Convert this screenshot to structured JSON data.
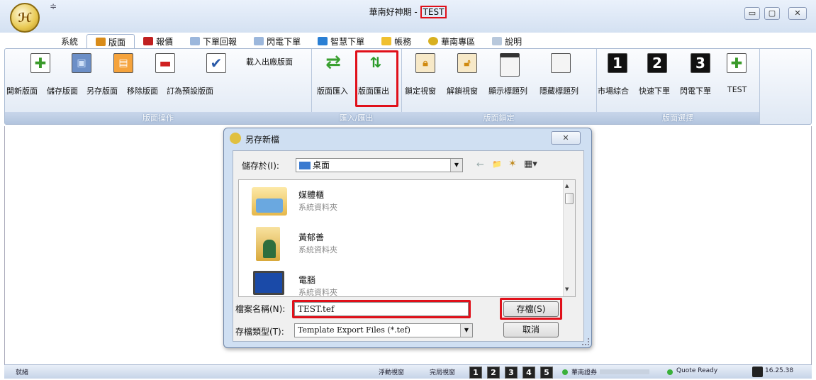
{
  "app": {
    "qat_text": "≑",
    "title_main": "華南好神期 -",
    "title_highlight": "TEST",
    "logo_text": "ℋ",
    "window_buttons": [
      "▭",
      "▢",
      "✕"
    ]
  },
  "menu": {
    "tabs": [
      {
        "label": "系統",
        "icon_color": "",
        "active": false
      },
      {
        "label": "版面",
        "icon_color": "#d98c1a",
        "active": true
      },
      {
        "label": "報價",
        "icon_color": "#c02020",
        "active": false
      },
      {
        "label": "下單回報",
        "icon_color": "#5c8fd0",
        "active": false
      },
      {
        "label": "閃電下單",
        "icon_color": "#5c8fd0",
        "active": false
      },
      {
        "label": "智慧下單",
        "icon_color": "#2a7fd4",
        "active": false
      },
      {
        "label": "帳務",
        "icon_color": "#f0c030",
        "active": false
      },
      {
        "label": "華南專區",
        "icon_color": "#d8b020",
        "active": false
      },
      {
        "label": "說明",
        "icon_color": "#8aa0b8",
        "active": false
      }
    ]
  },
  "ribbon": {
    "load_factory": "載入出廠版面",
    "groups": [
      {
        "title": "版面操作",
        "buttons": [
          "開新版面",
          "儲存版面",
          "另存版面",
          "移除版面",
          "訂為預設版面"
        ]
      },
      {
        "title": "匯入/匯出",
        "buttons": [
          "版面匯入",
          "版面匯出"
        ]
      },
      {
        "title": "版面鎖定",
        "buttons": [
          "鎖定視窗",
          "解鎖視窗",
          "顯示標題列",
          "隱藏標題列"
        ]
      },
      {
        "title": "版面選擇",
        "buttons": [
          "市場綜合",
          "快速下單",
          "閃電下單",
          "TEST"
        ]
      }
    ]
  },
  "dialog": {
    "title": "另存新檔",
    "close": "✕",
    "save_in_label": "儲存於(I):",
    "save_in_value": "桌面",
    "toolbar_icons": [
      "←",
      "📁",
      "✶",
      "▦▾"
    ],
    "files": [
      {
        "name": "媒體櫃",
        "sub": "系統資料夾"
      },
      {
        "name": "黃郁善",
        "sub": "系統資料夾"
      },
      {
        "name": "電腦",
        "sub": "系統資料夾"
      }
    ],
    "filename_label": "檔案名稱(N):",
    "filename_value": "TEST.tef",
    "filetype_label": "存檔類型(T):",
    "filetype_value": "Template Export Files (*.tef)",
    "save_button": "存檔(S)",
    "cancel_button": "取消"
  },
  "statusbar": {
    "ready": "就緒",
    "float_window": "浮動視窗",
    "fixed_window": "完局視窗",
    "layouts": [
      "1",
      "2",
      "3",
      "4",
      "5"
    ],
    "connection": "華南證券",
    "quote_status": "Quote Ready",
    "time": "16.25.38"
  }
}
